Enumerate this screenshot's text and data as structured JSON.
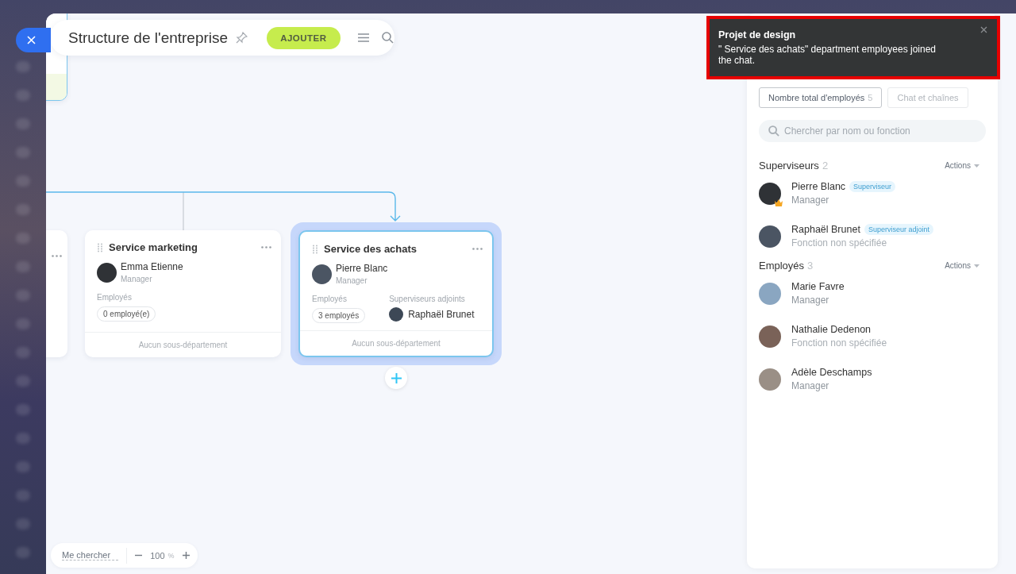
{
  "header": {
    "title": "Structure de l'entreprise",
    "add_button": "AJOUTER"
  },
  "nodes": [
    {
      "kind": "partial"
    },
    {
      "kind": "full",
      "selected": false,
      "title": "Service marketing",
      "head": {
        "name": "Emma Etienne",
        "role": "Manager"
      },
      "employees_label": "Employés",
      "employees_count": "0 employé(e)",
      "footer": "Aucun sous-département"
    },
    {
      "kind": "full",
      "selected": true,
      "title": "Service des achats",
      "head": {
        "name": "Pierre Blanc",
        "role": "Manager"
      },
      "employees_label": "Employés",
      "employees_count": "3 employés",
      "deputies_label": "Superviseurs adjoints",
      "deputy": "Raphaël Brunet",
      "footer": "Aucun sous-département"
    }
  ],
  "canvas_controls": {
    "find_me": "Me chercher",
    "zoom": "100",
    "zoom_unit": "%"
  },
  "notification": {
    "title": "Projet de design",
    "message": "\" Service des achats\" department employees joined the chat."
  },
  "panel": {
    "tabs": [
      {
        "label": "Nombre total d'employés",
        "count": "5",
        "selected": true
      },
      {
        "label": "Chat et chaînes",
        "selected": false
      }
    ],
    "search": {
      "placeholder": "Chercher par nom ou fonction"
    },
    "sections": [
      {
        "title": "Superviseurs",
        "count": "2",
        "actions": "Actions",
        "members": [
          {
            "name": "Pierre Blanc",
            "role": "Manager",
            "role_set": true,
            "badge": "Superviseur",
            "crown": true
          },
          {
            "name": "Raphaël Brunet",
            "role": "Fonction non spécifiée",
            "role_set": false,
            "badge": "Superviseur adjoint",
            "crown": false
          }
        ]
      },
      {
        "title": "Employés",
        "count": "3",
        "actions": "Actions",
        "members": [
          {
            "name": "Marie Favre",
            "role": "Manager",
            "role_set": true,
            "crown": false
          },
          {
            "name": "Nathalie Dedenon",
            "role": "Fonction non spécifiée",
            "role_set": false,
            "crown": false
          },
          {
            "name": "Adèle Deschamps",
            "role": "Manager",
            "role_set": true,
            "crown": false
          }
        ]
      }
    ]
  }
}
